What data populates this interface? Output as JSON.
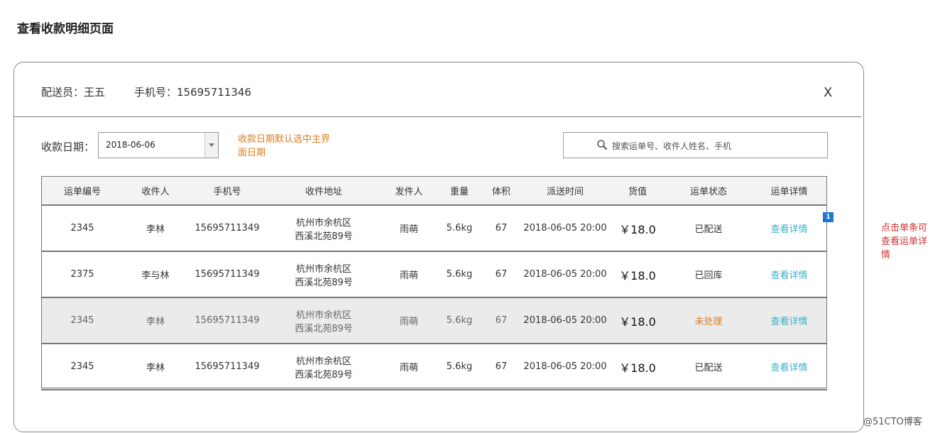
{
  "page_title": "查看收款明细页面",
  "header": {
    "courier": "配送员：王五",
    "phone": "手机号：15695711346",
    "close_label": "X"
  },
  "filter": {
    "date_label": "收款日期：",
    "date_value": "2018-06-06",
    "date_note": "收款日期默认选中主界面日期",
    "search_placeholder": "搜索运单号、收件人姓名、手机"
  },
  "table": {
    "headers": [
      "运单编号",
      "收件人",
      "手机号",
      "收件地址",
      "发件人",
      "重量",
      "体积",
      "派送时间",
      "货值",
      "运单状态",
      "运单详情"
    ],
    "rows": [
      {
        "id": "2345",
        "recipient": "李林",
        "phone": "15695711349",
        "addr1": "杭州市余杭区",
        "addr2": "西溪北苑89号",
        "sender": "雨萌",
        "weight": "5.6kg",
        "volume": "67",
        "time": "2018-06-05 20:00",
        "value": "￥18.0",
        "status": "已配送",
        "detail": "查看详情"
      },
      {
        "id": "2375",
        "recipient": "李与林",
        "phone": "15695711349",
        "addr1": "杭州市余杭区",
        "addr2": "西溪北苑89号",
        "sender": "雨萌",
        "weight": "5.6kg",
        "volume": "67",
        "time": "2018-06-05 20:00",
        "value": "￥18.0",
        "status": "已回库",
        "detail": "查看详情"
      },
      {
        "id": "2345",
        "recipient": "李林",
        "phone": "15695711349",
        "addr1": "杭州市余杭区",
        "addr2": "西溪北苑89号",
        "sender": "雨萌",
        "weight": "5.6kg",
        "volume": "67",
        "time": "2018-06-05 20:00",
        "value": "￥18.0",
        "status": "未处理",
        "detail": "查看详情"
      },
      {
        "id": "2345",
        "recipient": "李林",
        "phone": "15695711349",
        "addr1": "杭州市余杭区",
        "addr2": "西溪北苑89号",
        "sender": "雨萌",
        "weight": "5.6kg",
        "volume": "67",
        "time": "2018-06-05 20:00",
        "value": "￥18.0",
        "status": "已配送",
        "detail": "查看详情"
      }
    ]
  },
  "annotation": {
    "marker": "1",
    "note": "点击单条可查看运单详情"
  },
  "watermark": "@51CTO博客",
  "colors": {
    "accent_orange": "#e07b20",
    "link_teal": "#3ab0c6",
    "note_red": "#d0312d",
    "marker_blue": "#1f78c8"
  }
}
